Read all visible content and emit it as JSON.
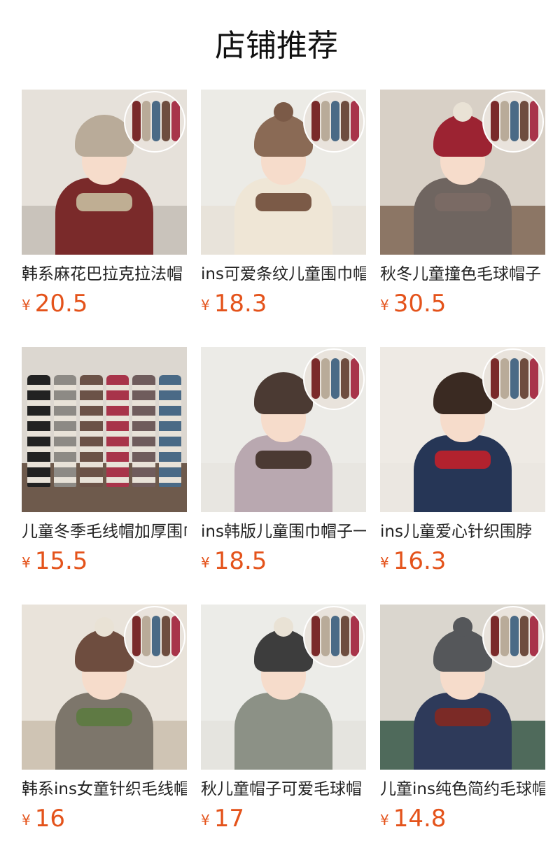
{
  "header": {
    "title": "店铺推荐"
  },
  "products": [
    {
      "name": "韩系麻花巴拉克拉法帽",
      "currency": "¥",
      "price": "20.5",
      "image": {
        "icon": "kid-hood-scarf-photo",
        "bg": "#e6e1da",
        "floor": "#c9c3bb",
        "body": "#7a2a2a",
        "hat": "#b9ab99",
        "scarf": "#bfae93",
        "pom": "",
        "inset": true
      }
    },
    {
      "name": "ins可爱条纹儿童围巾帽",
      "currency": "¥",
      "price": "18.3",
      "image": {
        "icon": "kid-brown-hat-photo",
        "bg": "#ecebe6",
        "floor": "#e8e3da",
        "body": "#efe6d6",
        "hat": "#8a6a55",
        "scarf": "#7b5a47",
        "pom": "#7b5a47",
        "inset": true
      }
    },
    {
      "name": "秋冬儿童撞色毛球帽子",
      "currency": "¥",
      "price": "30.5",
      "image": {
        "icon": "kid-red-pompom-hat-photo",
        "bg": "#d8d0c6",
        "floor": "#8c7665",
        "body": "#6f6560",
        "hat": "#9c2332",
        "scarf": "#7a6a64",
        "pom": "#e9e2d5",
        "inset": true
      }
    },
    {
      "name": "儿童冬季毛线帽加厚围巾",
      "currency": "¥",
      "price": "15.5",
      "image": {
        "icon": "knit-hats-scarves-display-photo",
        "bg": "#dcd7d0",
        "floor": "#6e5a4c",
        "stripes": [
          "#222",
          "#8d8a85",
          "#6b5247",
          "#a8344a",
          "#6f5c5c",
          "#4a6a86"
        ],
        "inset": false
      }
    },
    {
      "name": "ins韩版儿童围巾帽子一体",
      "currency": "¥",
      "price": "18.5",
      "image": {
        "icon": "kid-balaclava-photo",
        "bg": "#ecebe7",
        "floor": "#e8e6e1",
        "body": "#b9a8b0",
        "hat": "#4b3a33",
        "scarf": "#4b3a33",
        "pom": "",
        "inset": true
      }
    },
    {
      "name": "ins儿童爱心针织围脖",
      "currency": "¥",
      "price": "16.3",
      "image": {
        "icon": "kid-red-scarf-photo",
        "bg": "#eeeae4",
        "floor": "#ebe7e1",
        "body": "#263656",
        "hat": "#3a2a22",
        "scarf": "#b2222e",
        "pom": "",
        "inset": true
      }
    },
    {
      "name": "韩系ins女童针织毛线帽",
      "currency": "¥",
      "price": "16",
      "image": {
        "icon": "kid-brown-earflap-hat-photo",
        "bg": "#e9e3da",
        "floor": "#cfc4b4",
        "body": "#7d766b",
        "hat": "#6e4d3f",
        "scarf": "#5f7a44",
        "pom": "#e9e2d5",
        "inset": true
      }
    },
    {
      "name": "秋儿童帽子可爱毛球帽",
      "currency": "¥",
      "price": "17",
      "image": {
        "icon": "kid-gray-knit-hat-photo",
        "bg": "#ecece8",
        "floor": "#e5e4df",
        "body": "#8c9186",
        "hat": "#3d3d3d",
        "scarf": "#8c9186",
        "pom": "#e9e2d5",
        "inset": true
      }
    },
    {
      "name": "儿童ins纯色简约毛球帽",
      "currency": "¥",
      "price": "14.8",
      "image": {
        "icon": "kid-gray-pompom-hat-photo",
        "bg": "#dad6ce",
        "floor": "#4f6a5b",
        "body": "#2e3a5a",
        "hat": "#55575a",
        "scarf": "#7b2a26",
        "pom": "#55575a",
        "inset": true
      }
    }
  ]
}
